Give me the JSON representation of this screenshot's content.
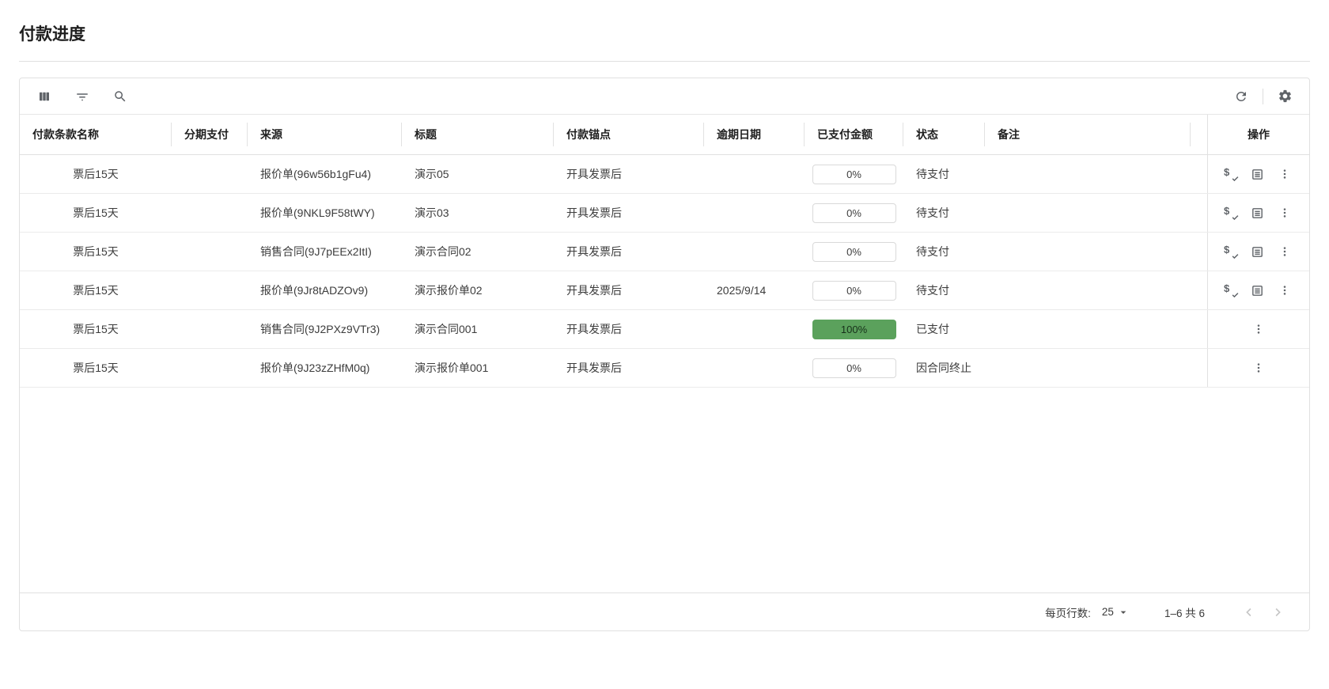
{
  "page": {
    "title": "付款进度"
  },
  "toolbar": {
    "left_icons": [
      "view-columns",
      "filter",
      "search"
    ],
    "right_icons": [
      "refresh",
      "settings"
    ]
  },
  "table": {
    "columns": [
      {
        "key": "terms",
        "label": "付款条款名称"
      },
      {
        "key": "installment",
        "label": "分期支付"
      },
      {
        "key": "source",
        "label": "来源"
      },
      {
        "key": "title",
        "label": "标题"
      },
      {
        "key": "anchor",
        "label": "付款锚点"
      },
      {
        "key": "overdue",
        "label": "逾期日期"
      },
      {
        "key": "paid",
        "label": "已支付金额"
      },
      {
        "key": "status",
        "label": "状态"
      },
      {
        "key": "remark",
        "label": "备注"
      },
      {
        "key": "actions",
        "label": "操作"
      }
    ],
    "rows": [
      {
        "terms": "票后15天",
        "installment": "",
        "source": "报价单(96w56b1gFu4)",
        "title": "演示05",
        "anchor": "开具发票后",
        "overdue": "",
        "paid": "0%",
        "paid_style": "outline",
        "status": "待支付",
        "remark": "",
        "actions": [
          "pay-check",
          "ledger",
          "more"
        ]
      },
      {
        "terms": "票后15天",
        "installment": "",
        "source": "报价单(9NKL9F58tWY)",
        "title": "演示03",
        "anchor": "开具发票后",
        "overdue": "",
        "paid": "0%",
        "paid_style": "outline",
        "status": "待支付",
        "remark": "",
        "actions": [
          "pay-check",
          "ledger",
          "more"
        ]
      },
      {
        "terms": "票后15天",
        "installment": "",
        "source": "销售合同(9J7pEEx2ItI)",
        "title": "演示合同02",
        "anchor": "开具发票后",
        "overdue": "",
        "paid": "0%",
        "paid_style": "outline",
        "status": "待支付",
        "remark": "",
        "actions": [
          "pay-check",
          "ledger",
          "more"
        ]
      },
      {
        "terms": "票后15天",
        "installment": "",
        "source": "报价单(9Jr8tADZOv9)",
        "title": "演示报价单02",
        "anchor": "开具发票后",
        "overdue": "2025/9/14",
        "paid": "0%",
        "paid_style": "outline",
        "status": "待支付",
        "remark": "",
        "actions": [
          "pay-check",
          "ledger",
          "more"
        ]
      },
      {
        "terms": "票后15天",
        "installment": "",
        "source": "销售合同(9J2PXz9VTr3)",
        "title": "演示合同001",
        "anchor": "开具发票后",
        "overdue": "",
        "paid": "100%",
        "paid_style": "filled-green",
        "status": "已支付",
        "remark": "",
        "actions": [
          "more"
        ]
      },
      {
        "terms": "票后15天",
        "installment": "",
        "source": "报价单(9J23zZHfM0q)",
        "title": "演示报价单001",
        "anchor": "开具发票后",
        "overdue": "",
        "paid": "0%",
        "paid_style": "outline",
        "status": "因合同终止",
        "remark": "",
        "actions": [
          "more"
        ]
      }
    ]
  },
  "pagination": {
    "rows_per_page_label": "每页行数:",
    "rows_per_page_value": "25",
    "range_label": "1–6 共 6"
  },
  "colors": {
    "paid_chip_green": "#5ba15c",
    "chip_border": "#d9d9d9",
    "icon_gray": "#5f6368",
    "card_border": "#e0e0e0"
  }
}
